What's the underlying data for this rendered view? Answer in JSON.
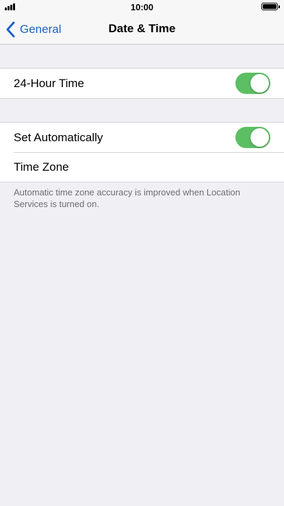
{
  "status_bar": {
    "time": "10:00",
    "signal_bars": 4,
    "battery_level": 1.0
  },
  "nav": {
    "back_label": "General",
    "title": "Date & Time"
  },
  "settings": {
    "group1": {
      "hour_24_label": "24-Hour Time",
      "hour_24_on": true
    },
    "group2": {
      "set_auto_label": "Set Automatically",
      "set_auto_on": true,
      "time_zone_label": "Time Zone"
    },
    "footnote": "Automatic time zone accuracy is improved when Location Services is turned on."
  },
  "colors": {
    "accent": "#1f5fc8",
    "toggle_on": "#5cbf63",
    "background": "#efeff4"
  }
}
